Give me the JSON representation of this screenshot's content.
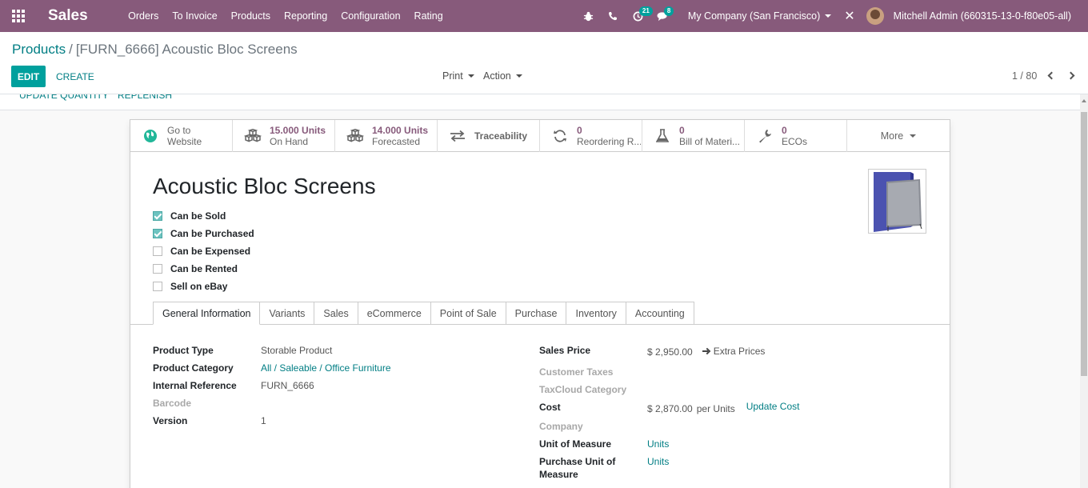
{
  "navbar": {
    "brand": "Sales",
    "menu": [
      "Orders",
      "To Invoice",
      "Products",
      "Reporting",
      "Configuration",
      "Rating"
    ],
    "activity_count": "21",
    "message_count": "8",
    "company": "My Company (San Francisco)",
    "user": "Mitchell Admin (660315-13-0-f80e05-all)",
    "bg_color": "#875a7b"
  },
  "breadcrumb": {
    "parent": "Products",
    "separator": "/",
    "current": "[FURN_6666] Acoustic Bloc Screens"
  },
  "toolbar": {
    "edit_label": "EDIT",
    "create_label": "CREATE",
    "print_label": "Print",
    "action_label": "Action",
    "pager": "1 / 80"
  },
  "statusbar": {
    "update_quantity": "UPDATE QUANTITY",
    "replenish": "REPLENISH"
  },
  "smart_buttons": [
    {
      "value": "Go to",
      "label": "Website",
      "icon": "globe-icon"
    },
    {
      "value": "15.000 Units",
      "label": "On Hand",
      "icon": "cubes-icon"
    },
    {
      "value": "14.000 Units",
      "label": "Forecasted",
      "icon": "cubes-icon"
    },
    {
      "value": "",
      "label": "Traceability",
      "icon": "exchange-icon"
    },
    {
      "value": "0",
      "label": "Reordering R...",
      "icon": "refresh-icon"
    },
    {
      "value": "0",
      "label": "Bill of Materi...",
      "icon": "flask-icon"
    },
    {
      "value": "0",
      "label": "ECOs",
      "icon": "wrench-icon"
    }
  ],
  "more_label": "More",
  "product": {
    "name": "Acoustic Bloc Screens",
    "checkboxes": [
      {
        "label": "Can be Sold",
        "checked": true
      },
      {
        "label": "Can be Purchased",
        "checked": true
      },
      {
        "label": "Can be Expensed",
        "checked": false
      },
      {
        "label": "Can be Rented",
        "checked": false
      },
      {
        "label": "Sell on eBay",
        "checked": false
      }
    ]
  },
  "tabs": [
    "General Information",
    "Variants",
    "Sales",
    "eCommerce",
    "Point of Sale",
    "Purchase",
    "Inventory",
    "Accounting"
  ],
  "general_left": [
    {
      "label": "Product Type",
      "value": "Storable Product"
    },
    {
      "label": "Product Category",
      "value": "All / Saleable / Office Furniture"
    },
    {
      "label": "Internal Reference",
      "value": "FURN_6666"
    },
    {
      "label": "Barcode",
      "value": ""
    },
    {
      "label": "Version",
      "value": "1"
    }
  ],
  "general_right": {
    "sales_price_label": "Sales Price",
    "sales_price": "$ 2,950.00",
    "extra_prices": "Extra Prices",
    "customer_taxes_label": "Customer Taxes",
    "taxcloud_label": "TaxCloud Category",
    "cost_label": "Cost",
    "cost": "$ 2,870.00",
    "cost_unit": "per Units",
    "update_cost": "Update Cost",
    "company_label": "Company",
    "uom_label": "Unit of Measure",
    "uom": "Units",
    "purchase_uom_label": "Purchase Unit of Measure",
    "purchase_uom": "Units"
  }
}
